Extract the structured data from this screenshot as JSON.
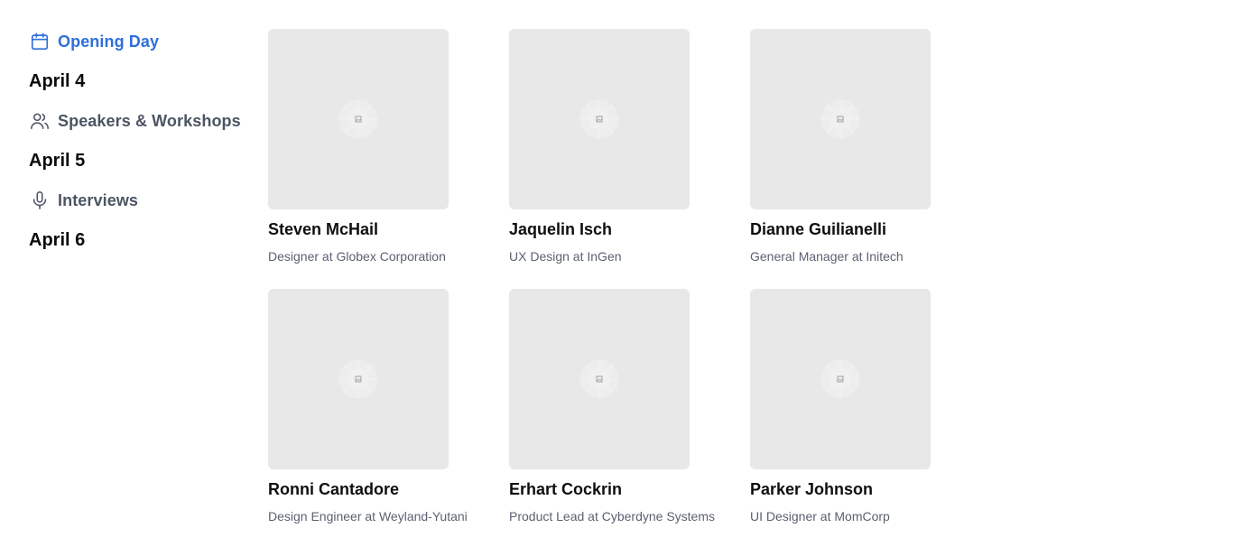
{
  "colors": {
    "accent": "#2f6fdb",
    "nav_text": "#4b5563",
    "placeholder_bg": "#e8e8e8",
    "role_text": "#5b6170"
  },
  "sidebar": {
    "tab_opening": {
      "label": "Opening Day",
      "icon": "calendar-icon",
      "active": true
    },
    "date_1": "April 4",
    "tab_speakers": {
      "label": "Speakers & Workshops",
      "icon": "users-icon"
    },
    "date_2": "April 5",
    "tab_interviews": {
      "label": "Interviews",
      "icon": "microphone-icon"
    },
    "date_3": "April 6"
  },
  "speakers": [
    {
      "name": "Steven McHail",
      "role": "Designer at Globex Corporation"
    },
    {
      "name": "Jaquelin Isch",
      "role": "UX Design at InGen"
    },
    {
      "name": "Dianne Guilianelli",
      "role": "General Manager at Initech"
    },
    {
      "name": "Ronni Cantadore",
      "role": "Design Engineer at Weyland-Yutani"
    },
    {
      "name": "Erhart Cockrin",
      "role": "Product Lead at Cyberdyne Systems"
    },
    {
      "name": "Parker Johnson",
      "role": "UI Designer at MomCorp"
    }
  ]
}
